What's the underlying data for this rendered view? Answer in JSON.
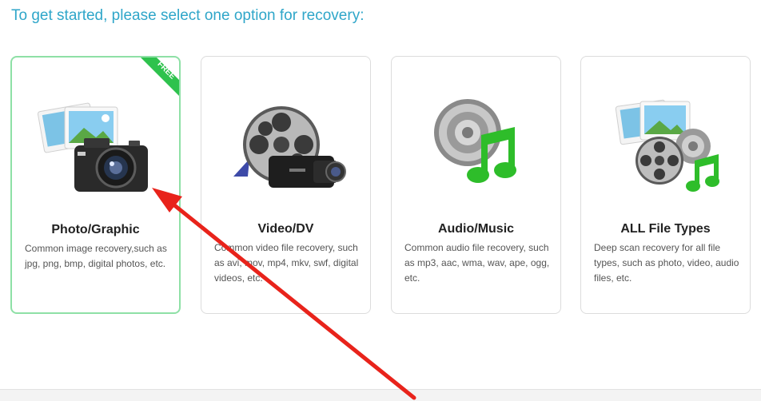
{
  "prompt": "To get started, please select one option for recovery:",
  "options": [
    {
      "title": "Photo/Graphic",
      "description": "Common image recovery,such as jpg, png, bmp, digital photos, etc.",
      "icon": "photo-camera-icon",
      "badge": "FREE",
      "selected": true
    },
    {
      "title": "Video/DV",
      "description": "Common video file recovery, such as avi, mov, mp4, mkv, swf, digital videos, etc.",
      "icon": "film-reel-camcorder-icon",
      "selected": false
    },
    {
      "title": "Audio/Music",
      "description": "Common audio file recovery, such as mp3, aac, wma, wav, ape, ogg, etc.",
      "icon": "speaker-music-note-icon",
      "selected": false
    },
    {
      "title": "ALL File Types",
      "description": "Deep scan recovery for all file types, such as photo, video, audio files, etc.",
      "icon": "all-files-icon",
      "selected": false
    }
  ],
  "colors": {
    "prompt": "#2fa6c9",
    "selected_border": "#8ee0a6",
    "badge": "#2ec24d",
    "arrow": "#e8231b"
  }
}
